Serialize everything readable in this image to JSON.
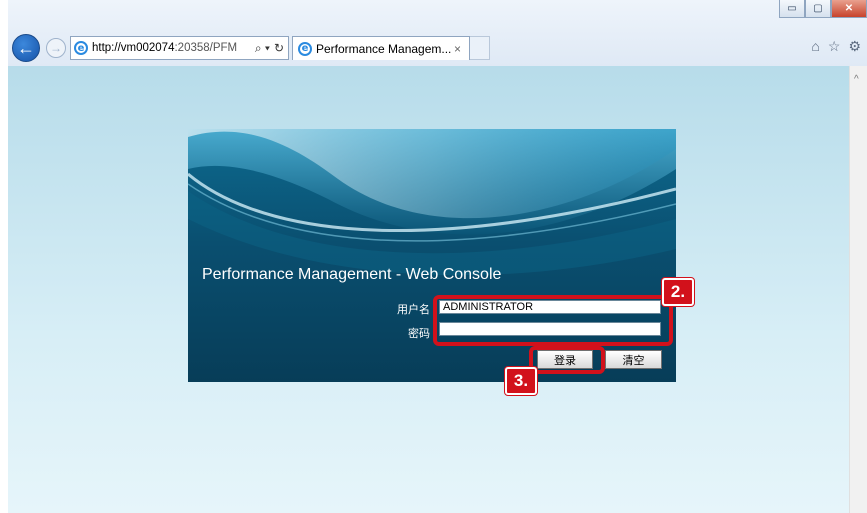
{
  "browser": {
    "url_host": "http://vm002074",
    "url_rest": ":20358/PFM",
    "tab_title": "Performance Managem...",
    "tab_close": "×",
    "search_glyph": "⌕ ▾",
    "refresh_glyph": "↻",
    "back_glyph": "←",
    "forward_glyph": "→",
    "ie_glyph": "e",
    "home_glyph": "⌂",
    "star_glyph": "☆",
    "gear_glyph": "⚙",
    "minimize_glyph": "▭",
    "maximize_glyph": "▢",
    "close_glyph": "✕",
    "scroll_up_glyph": "^"
  },
  "login": {
    "title": "Performance Management - Web Console",
    "username_label": "用户名",
    "username_value": "ADMINISTRATOR",
    "password_label": "密码",
    "password_value": "",
    "login_button": "登录",
    "clear_button": "清空"
  },
  "callouts": {
    "step2": "2.",
    "step3": "3."
  },
  "colors": {
    "highlight": "#d2111b",
    "panel_dark": "#073d58",
    "panel_light": "#0d6b90"
  }
}
